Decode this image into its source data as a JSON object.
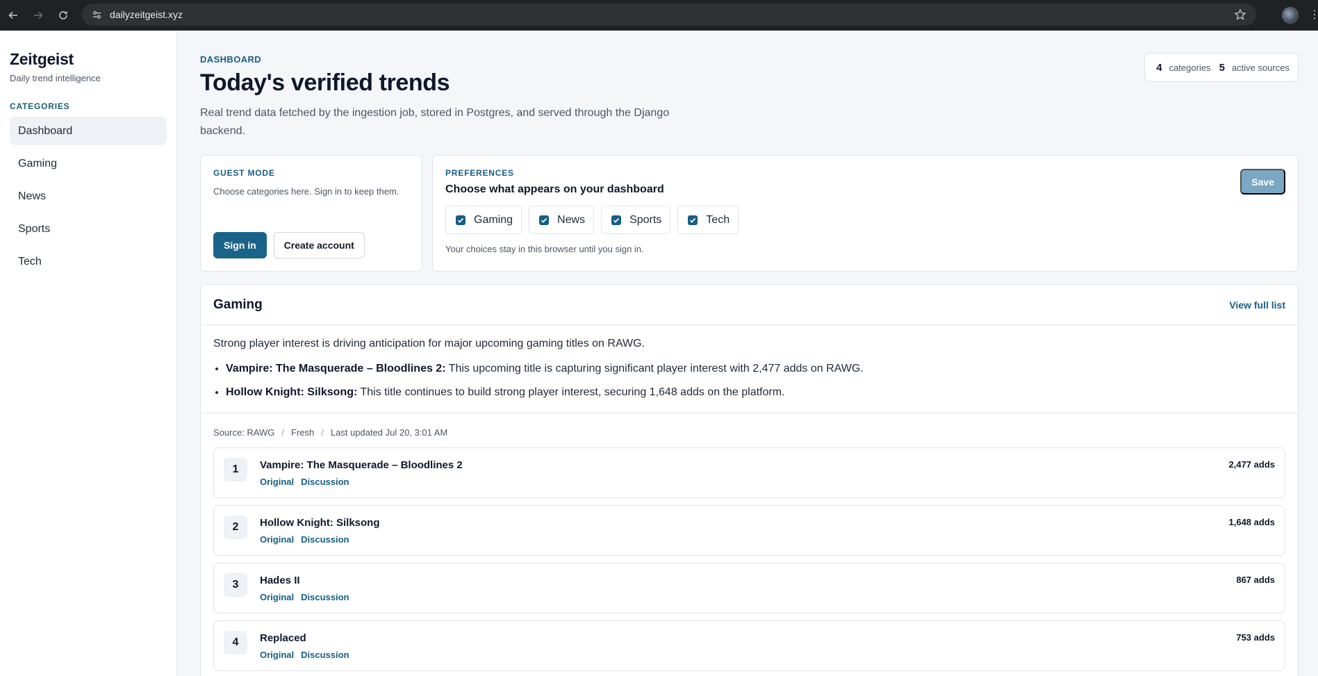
{
  "browser": {
    "url": "dailyzeitgeist.xyz"
  },
  "sidebar": {
    "brand": "Zeitgeist",
    "tagline": "Daily trend intelligence",
    "section_label": "CATEGORIES",
    "items": [
      {
        "label": "Dashboard",
        "active": true
      },
      {
        "label": "Gaming"
      },
      {
        "label": "News"
      },
      {
        "label": "Sports"
      },
      {
        "label": "Tech"
      }
    ]
  },
  "header": {
    "eyebrow": "DASHBOARD",
    "title": "Today's verified trends",
    "subtitle": "Real trend data fetched by the ingestion job, stored in Postgres, and served through the Django backend."
  },
  "stats": {
    "categories_count": "4",
    "categories_label": "categories",
    "sources_count": "5",
    "sources_label": "active sources"
  },
  "guest": {
    "eyebrow": "GUEST MODE",
    "description": "Choose categories here. Sign in to keep them.",
    "sign_in": "Sign in",
    "create_account": "Create account"
  },
  "preferences": {
    "eyebrow": "PREFERENCES",
    "heading": "Choose what appears on your dashboard",
    "save": "Save",
    "options": [
      {
        "label": "Gaming",
        "checked": true
      },
      {
        "label": "News",
        "checked": true
      },
      {
        "label": "Sports",
        "checked": true
      },
      {
        "label": "Tech",
        "checked": true
      }
    ],
    "note": "Your choices stay in this browser until you sign in."
  },
  "gaming": {
    "title": "Gaming",
    "view_full": "View full list",
    "summary": "Strong player interest is driving anticipation for major upcoming gaming titles on RAWG.",
    "bullets": [
      {
        "bold": "Vampire: The Masquerade – Bloodlines 2:",
        "text": " This upcoming title is capturing significant player interest with 2,477 adds on RAWG."
      },
      {
        "bold": "Hollow Knight: Silksong:",
        "text": " This title continues to build strong player interest, securing 1,648 adds on the platform."
      }
    ],
    "meta": {
      "source": "Source: RAWG",
      "status": "Fresh",
      "updated": "Last updated Jul 20, 3:01 AM",
      "separator": "/"
    },
    "link_original": "Original",
    "link_discussion": "Discussion",
    "rows": [
      {
        "rank": "1",
        "title": "Vampire: The Masquerade – Bloodlines 2",
        "adds": "2,477 adds"
      },
      {
        "rank": "2",
        "title": "Hollow Knight: Silksong",
        "adds": "1,648 adds"
      },
      {
        "rank": "3",
        "title": "Hades II",
        "adds": "867 adds"
      },
      {
        "rank": "4",
        "title": "Replaced",
        "adds": "753 adds"
      }
    ]
  },
  "colors": {
    "accent": "#155e85",
    "primary_button": "#1b6489",
    "save_button": "#7aa7c2"
  }
}
